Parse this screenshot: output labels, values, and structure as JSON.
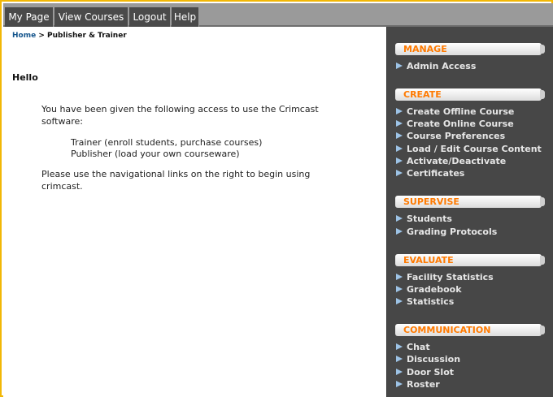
{
  "nav": {
    "tabs": [
      "My Page",
      "View Courses",
      "Logout",
      "Help"
    ]
  },
  "breadcrumb": {
    "home": "Home",
    "separator": " > ",
    "current": "Publisher & Trainer"
  },
  "main": {
    "greeting": "Hello",
    "intro": "You have been given the following access to use the Crimcast software:",
    "roles": [
      "Trainer (enroll students, purchase courses)",
      "Publisher (load your own courseware)"
    ],
    "instructions": "Please use the navigational links on the right to begin using crimcast."
  },
  "sidebar": {
    "sections": [
      {
        "title": "MANAGE",
        "items": [
          "Admin Access"
        ]
      },
      {
        "title": "CREATE",
        "items": [
          "Create Offline Course",
          "Create Online Course",
          "Course Preferences",
          "Load / Edit Course Content",
          "Activate/Deactivate",
          "Certificates"
        ]
      },
      {
        "title": "SUPERVISE",
        "items": [
          "Students",
          "Grading Protocols"
        ]
      },
      {
        "title": "EVALUATE",
        "items": [
          "Facility Statistics",
          "Gradebook",
          "Statistics"
        ]
      },
      {
        "title": "COMMUNICATION",
        "items": [
          "Chat",
          "Discussion",
          "Door Slot",
          "Roster"
        ]
      }
    ]
  },
  "colors": {
    "frame_border": "#f2b705",
    "tab_bg": "#4a4a4a",
    "sidebar_bg": "#474747",
    "section_title": "#ff7a00",
    "nav_arrow": "#9dc3e6",
    "breadcrumb_link": "#16568d"
  }
}
